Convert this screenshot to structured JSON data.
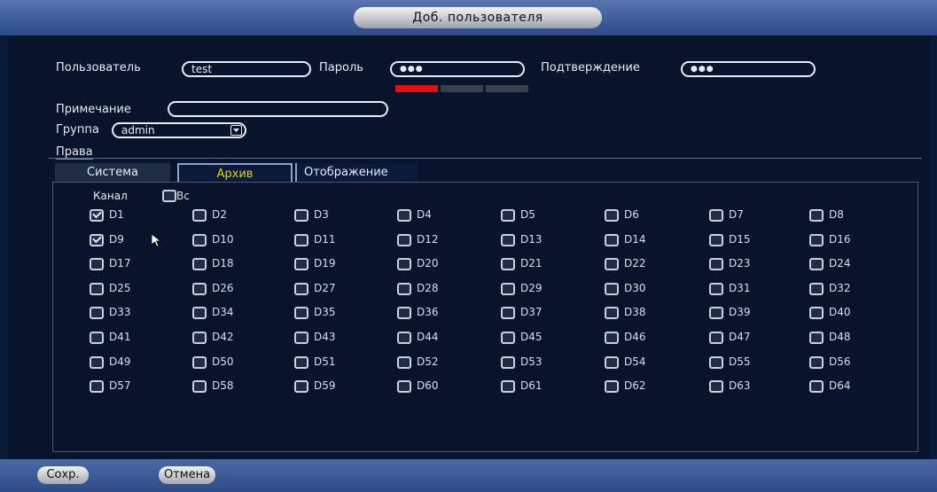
{
  "window": {
    "title": "Доб. пользователя"
  },
  "form": {
    "user_label": "Пользователь",
    "user_value": "test",
    "password_label": "Пароль",
    "password_value": "●●●",
    "confirm_label": "Подтверждение",
    "confirm_value": "●●●",
    "note_label": "Примечание",
    "note_value": "",
    "group_label": "Группа",
    "group_value": "admin",
    "rights_label": "Права"
  },
  "password_strength": {
    "level": 1,
    "segments": 3,
    "colors": [
      "#e01010",
      "#3a3f4a",
      "#3a3f4a"
    ]
  },
  "tabs": [
    {
      "label": "Система",
      "active": false
    },
    {
      "label": "Архив",
      "active": true
    },
    {
      "label": "Отображение",
      "active": false
    }
  ],
  "channels": {
    "header_label": "Канал",
    "select_all_label": "Вс",
    "items": [
      {
        "label": "D1",
        "checked": true
      },
      {
        "label": "D2",
        "checked": false
      },
      {
        "label": "D3",
        "checked": false
      },
      {
        "label": "D4",
        "checked": false
      },
      {
        "label": "D5",
        "checked": false
      },
      {
        "label": "D6",
        "checked": false
      },
      {
        "label": "D7",
        "checked": false
      },
      {
        "label": "D8",
        "checked": false
      },
      {
        "label": "D9",
        "checked": true
      },
      {
        "label": "D10",
        "checked": false
      },
      {
        "label": "D11",
        "checked": false
      },
      {
        "label": "D12",
        "checked": false
      },
      {
        "label": "D13",
        "checked": false
      },
      {
        "label": "D14",
        "checked": false
      },
      {
        "label": "D15",
        "checked": false
      },
      {
        "label": "D16",
        "checked": false
      },
      {
        "label": "D17",
        "checked": false
      },
      {
        "label": "D18",
        "checked": false
      },
      {
        "label": "D19",
        "checked": false
      },
      {
        "label": "D20",
        "checked": false
      },
      {
        "label": "D21",
        "checked": false
      },
      {
        "label": "D22",
        "checked": false
      },
      {
        "label": "D23",
        "checked": false
      },
      {
        "label": "D24",
        "checked": false
      },
      {
        "label": "D25",
        "checked": false
      },
      {
        "label": "D26",
        "checked": false
      },
      {
        "label": "D27",
        "checked": false
      },
      {
        "label": "D28",
        "checked": false
      },
      {
        "label": "D29",
        "checked": false
      },
      {
        "label": "D30",
        "checked": false
      },
      {
        "label": "D31",
        "checked": false
      },
      {
        "label": "D32",
        "checked": false
      },
      {
        "label": "D33",
        "checked": false
      },
      {
        "label": "D34",
        "checked": false
      },
      {
        "label": "D35",
        "checked": false
      },
      {
        "label": "D36",
        "checked": false
      },
      {
        "label": "D37",
        "checked": false
      },
      {
        "label": "D38",
        "checked": false
      },
      {
        "label": "D39",
        "checked": false
      },
      {
        "label": "D40",
        "checked": false
      },
      {
        "label": "D41",
        "checked": false
      },
      {
        "label": "D42",
        "checked": false
      },
      {
        "label": "D43",
        "checked": false
      },
      {
        "label": "D44",
        "checked": false
      },
      {
        "label": "D45",
        "checked": false
      },
      {
        "label": "D46",
        "checked": false
      },
      {
        "label": "D47",
        "checked": false
      },
      {
        "label": "D48",
        "checked": false
      },
      {
        "label": "D49",
        "checked": false
      },
      {
        "label": "D50",
        "checked": false
      },
      {
        "label": "D51",
        "checked": false
      },
      {
        "label": "D52",
        "checked": false
      },
      {
        "label": "D53",
        "checked": false
      },
      {
        "label": "D54",
        "checked": false
      },
      {
        "label": "D55",
        "checked": false
      },
      {
        "label": "D56",
        "checked": false
      },
      {
        "label": "D57",
        "checked": false
      },
      {
        "label": "D58",
        "checked": false
      },
      {
        "label": "D59",
        "checked": false
      },
      {
        "label": "D60",
        "checked": false
      },
      {
        "label": "D61",
        "checked": false
      },
      {
        "label": "D62",
        "checked": false
      },
      {
        "label": "D63",
        "checked": false
      },
      {
        "label": "D64",
        "checked": false
      }
    ]
  },
  "buttons": {
    "save_label": "Сохр.",
    "cancel_label": "Отмена"
  },
  "theme": {
    "active_tab_text": "#f0d000",
    "strength_weak": "#e01010"
  }
}
